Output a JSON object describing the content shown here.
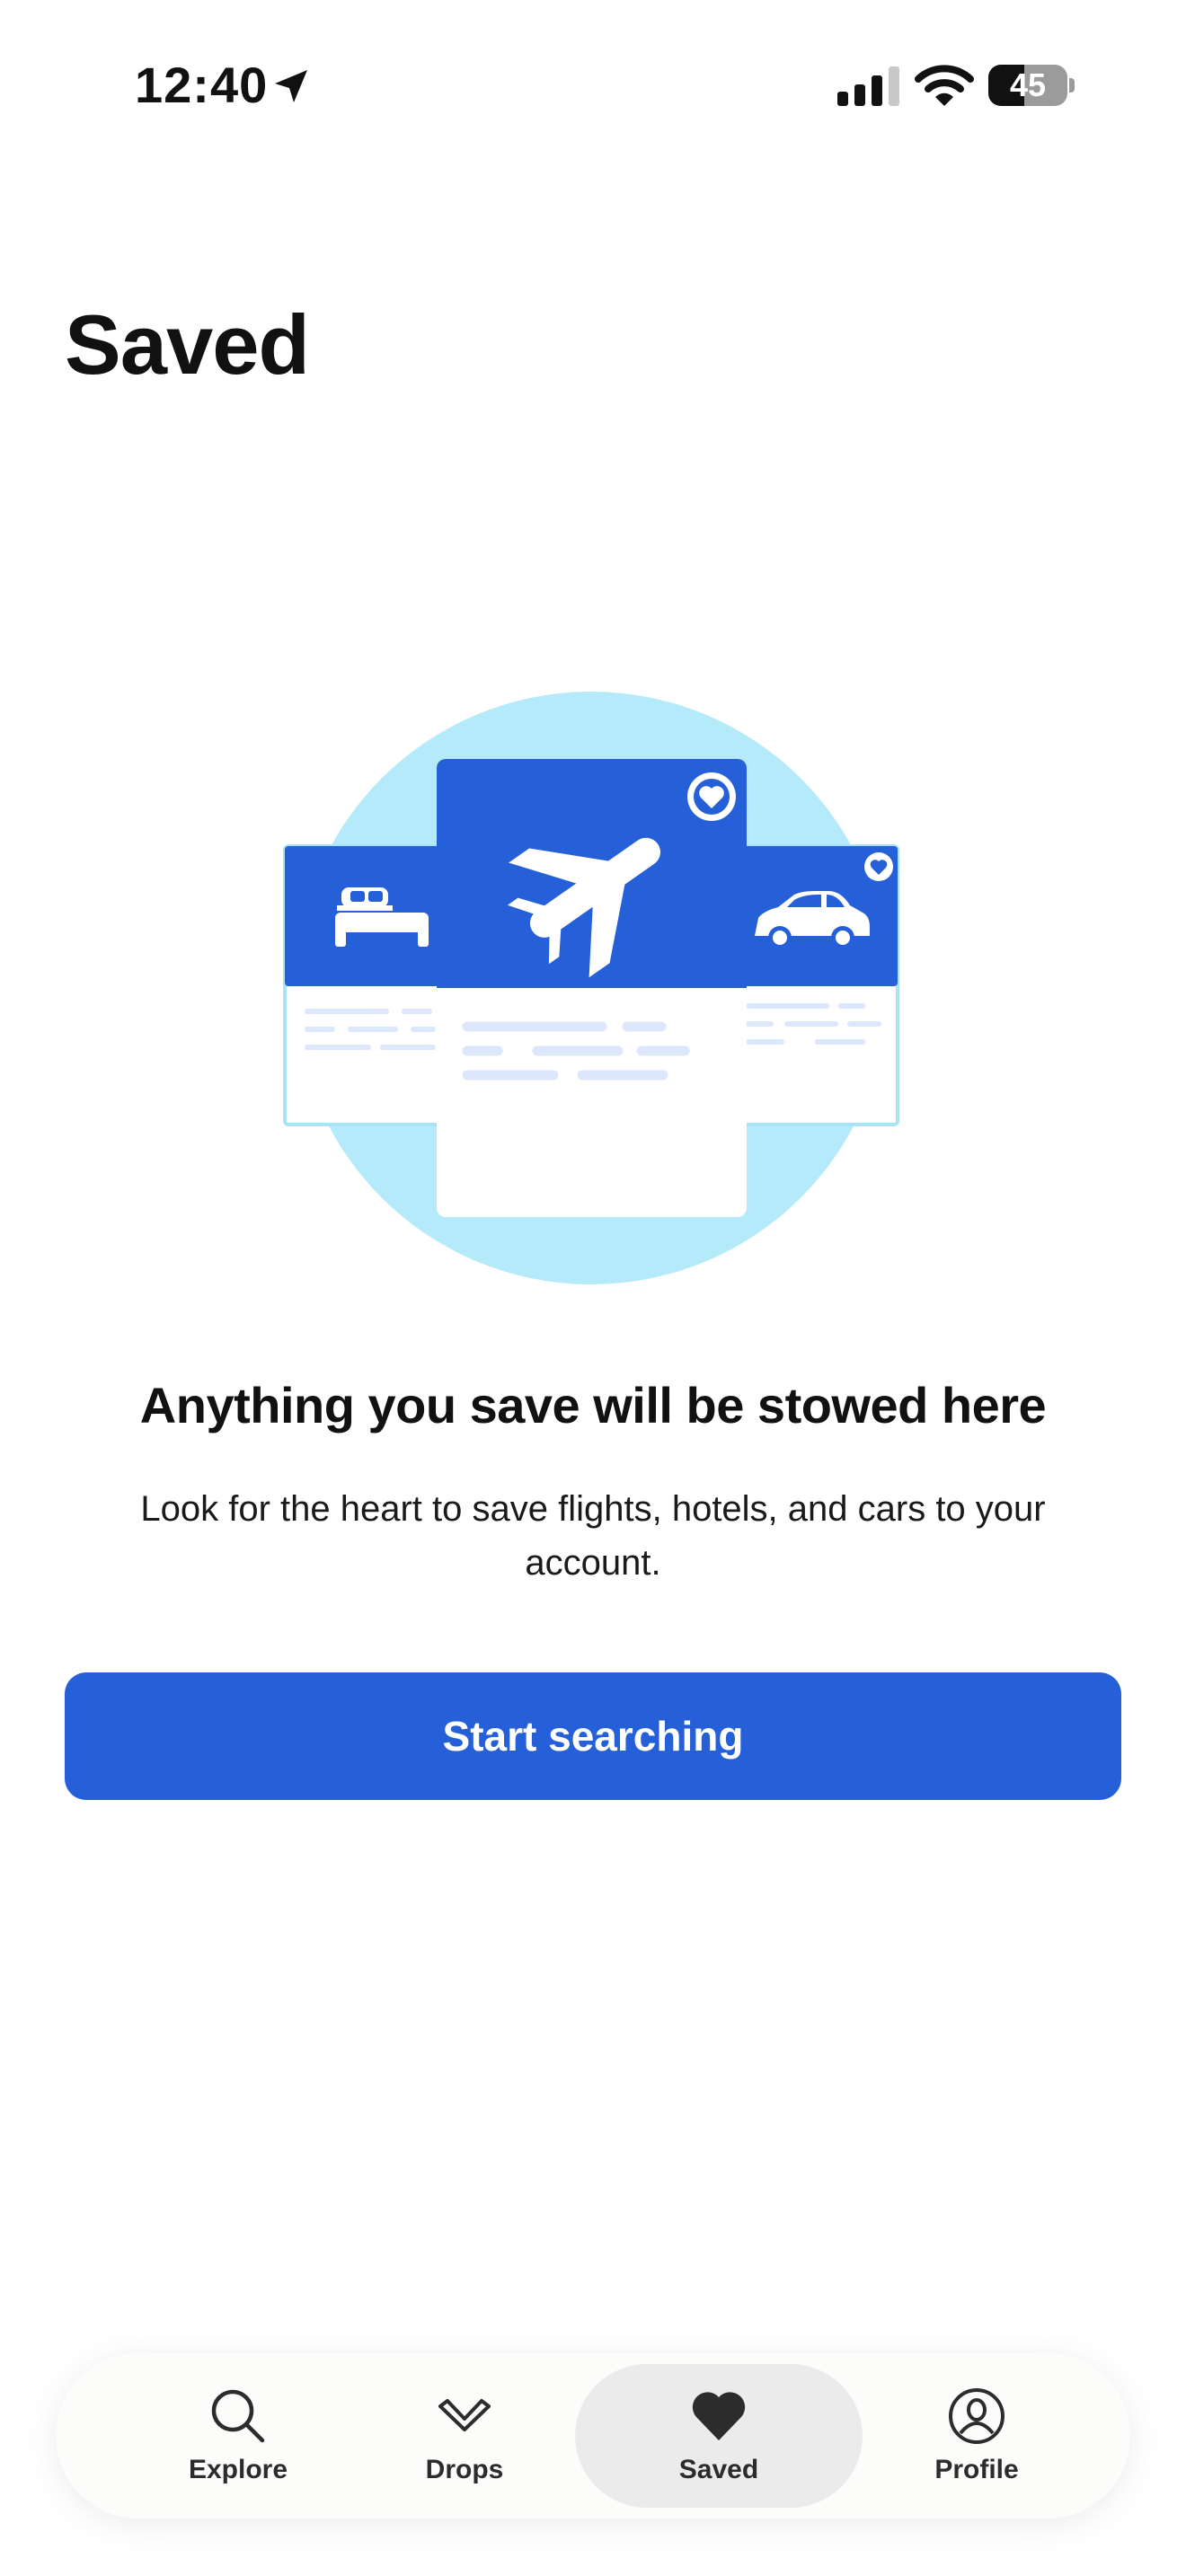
{
  "status_bar": {
    "time": "12:40",
    "battery_level": "45",
    "icons": [
      "location-arrow-icon",
      "cellular-signal-icon",
      "wifi-icon",
      "battery-icon"
    ]
  },
  "page": {
    "title": "Saved"
  },
  "illustration": {
    "icons": [
      "bed-icon",
      "airplane-icon",
      "car-icon",
      "heart-icon"
    ],
    "colors": {
      "circle": "#b5eafa",
      "card_header": "#2660d9",
      "card_border": "#a8e4f5",
      "line": "#dce7fb"
    }
  },
  "empty_state": {
    "heading": "Anything you save will be stowed here",
    "body": "Look for the heart to save flights, hotels, and cars to your account.",
    "cta_label": "Start searching"
  },
  "tab_bar": {
    "tabs": [
      {
        "label": "Explore",
        "icon": "search-icon",
        "active": false
      },
      {
        "label": "Drops",
        "icon": "chevron-down-icon",
        "active": false
      },
      {
        "label": "Saved",
        "icon": "heart-icon",
        "active": true
      },
      {
        "label": "Profile",
        "icon": "profile-icon",
        "active": false
      }
    ]
  },
  "colors": {
    "accent": "#2660d9",
    "text": "#111111",
    "tab_active_bg": "#ebebeb"
  }
}
